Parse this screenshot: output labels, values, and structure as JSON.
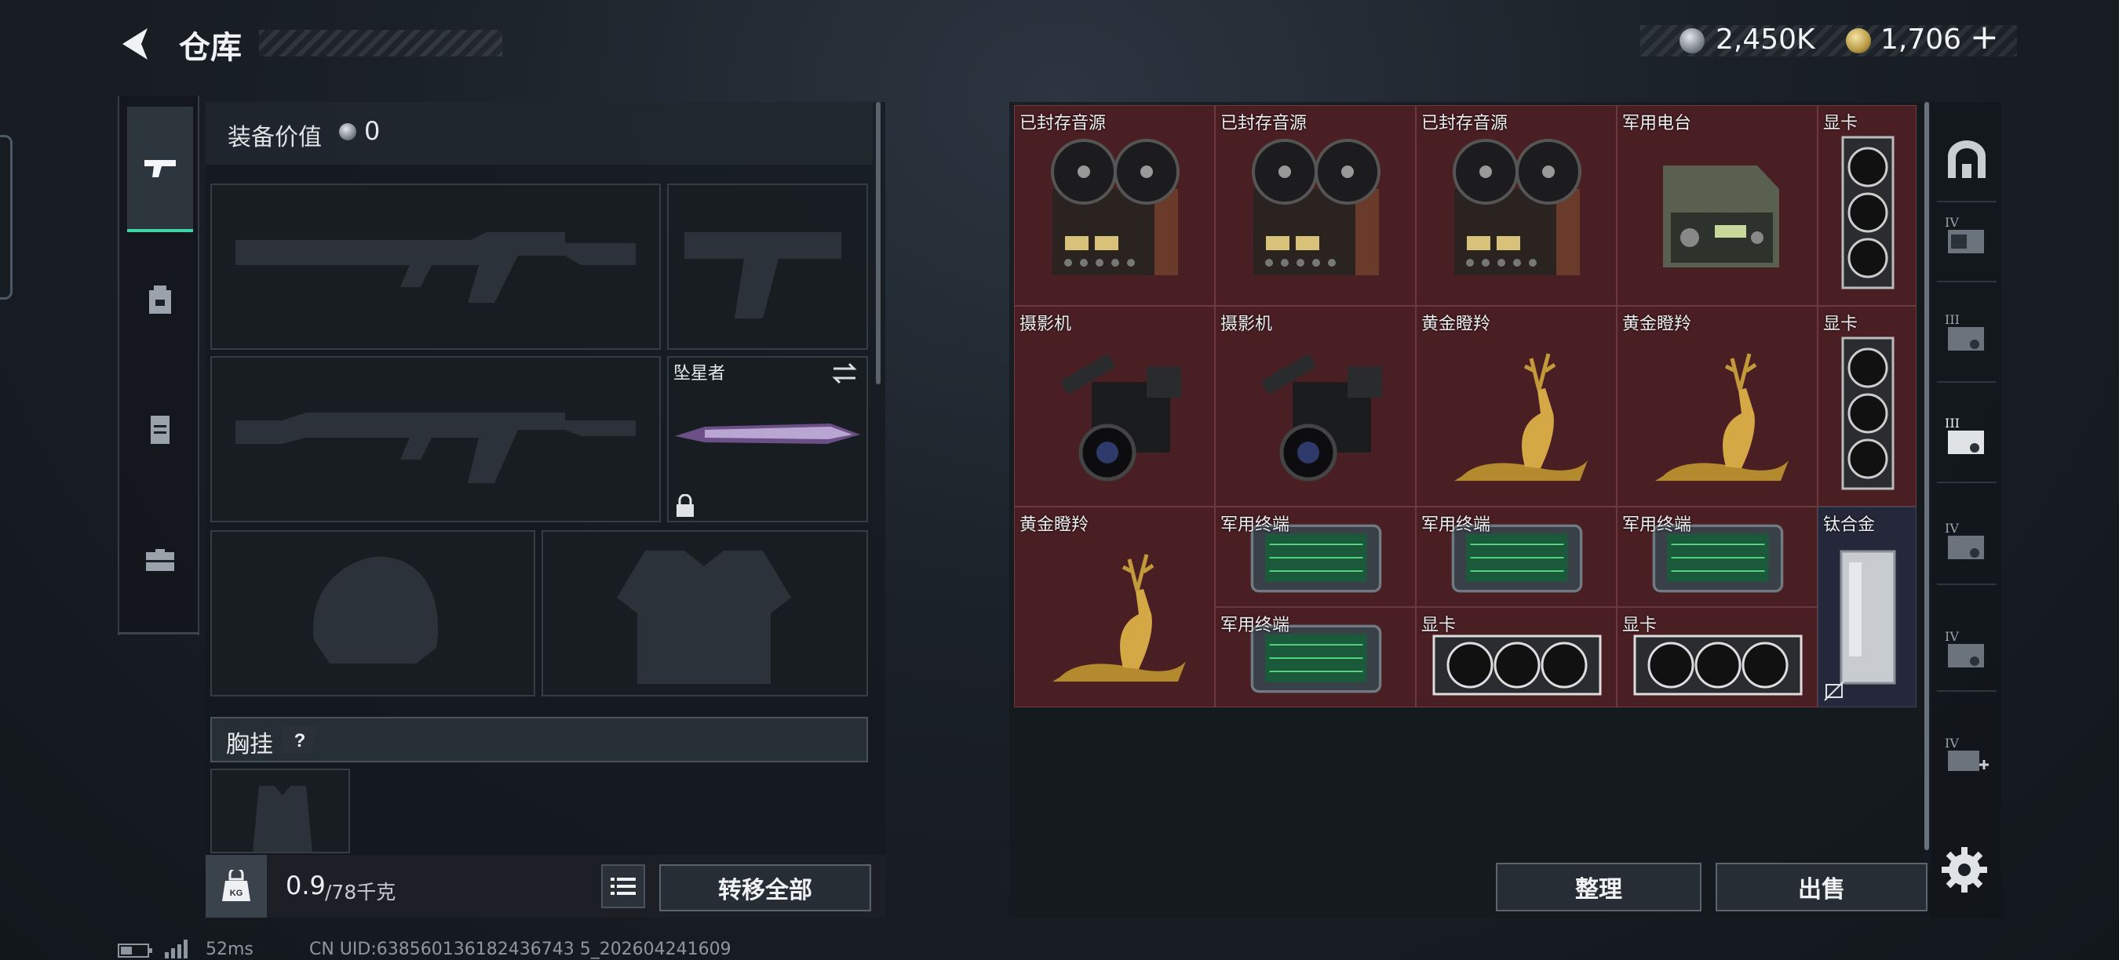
{
  "header": {
    "title": "仓库",
    "currency_silver": "2,450K",
    "currency_gold": "1,706",
    "add_label": "+"
  },
  "equipment": {
    "value_label": "装备价值",
    "value": "0",
    "melee_name": "坠星者",
    "rig_label": "胸挂",
    "weight_current": "0.9",
    "weight_max": "/78千克",
    "transfer_all_label": "转移全部"
  },
  "stash": {
    "items": [
      {
        "name": "已封存音源",
        "type": "reel"
      },
      {
        "name": "已封存音源",
        "type": "reel"
      },
      {
        "name": "已封存音源",
        "type": "reel"
      },
      {
        "name": "军用电台",
        "type": "radio"
      },
      {
        "name": "显卡",
        "type": "gpu-v"
      },
      {
        "name": "摄影机",
        "type": "camera"
      },
      {
        "name": "摄影机",
        "type": "camera"
      },
      {
        "name": "黄金瞪羚",
        "type": "gazelle"
      },
      {
        "name": "黄金瞪羚",
        "type": "gazelle"
      },
      {
        "name": "显卡",
        "type": "gpu-v"
      },
      {
        "name": "黄金瞪羚",
        "type": "gazelle"
      },
      {
        "name": "军用终端",
        "type": "terminal"
      },
      {
        "name": "军用终端",
        "type": "terminal"
      },
      {
        "name": "军用终端",
        "type": "terminal"
      },
      {
        "name": "钛合金",
        "type": "titanium"
      },
      {
        "name": "军用终端",
        "type": "terminal"
      },
      {
        "name": "显卡",
        "type": "gpu-h"
      },
      {
        "name": "显卡",
        "type": "gpu-h"
      }
    ],
    "sort_label": "整理",
    "sell_label": "出售"
  },
  "status": {
    "ping": "52ms",
    "uid": "CN UID:638560136182436743 5_202604241609"
  },
  "colors": {
    "accent": "#3ed7a4",
    "item_red": "#4a1f23",
    "item_dark": "#25283a"
  }
}
